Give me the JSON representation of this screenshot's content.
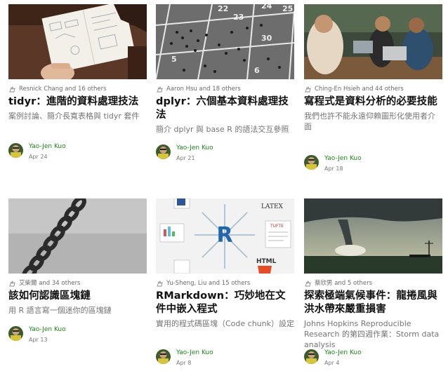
{
  "colors": {
    "author_link": "#1a8917",
    "meta_text": "#6b6b6b",
    "desc_text": "#757575"
  },
  "cards": [
    {
      "image": "notebook-hand-drawing",
      "claps_icon": "clap-icon",
      "claps": "Resnick Chang and 16 others",
      "title": "tidyr：進階的資料處理技法",
      "description": "案例討論、簡介長寬表格與 tidyr 套件",
      "author": "Yao-Jen Kuo",
      "date": "Apr 24"
    },
    {
      "image": "crowd-on-numbered-grid",
      "grid_numbers": [
        "22",
        "23",
        "24",
        "25",
        "30",
        "5",
        "6"
      ],
      "claps_icon": "clap-icon",
      "claps": "Aaron Hsu and 18 others",
      "title": "dplyr：六個基本資料處理技法",
      "description": "簡介 dplyr 與 base R 的語法交互參照",
      "author": "Yao-Jen Kuo",
      "date": "Apr 21"
    },
    {
      "image": "people-with-laptops",
      "claps_icon": "clap-icon",
      "claps": "Ching-En Hsieh and 44 others",
      "title": "寫程式是資料分析的必要技能",
      "description": "我們也許不能永遠仰賴圖形化使用者介面",
      "author": "Yao-Jen Kuo",
      "date": "Apr 18"
    },
    {
      "image": "chain-links",
      "claps_icon": "clap-icon",
      "claps": "艾柴爾 and 34 others",
      "title": "該如何認識區塊鏈",
      "description": "用 R 語言寫一個迷你的區塊鏈",
      "author": "Yao-Jen Kuo",
      "date": "Apr 13"
    },
    {
      "image": "rmarkdown-diagram",
      "diagram_labels": {
        "center": "R",
        "latex": "LATEX",
        "tufte": "TUFTE",
        "html": "HTML"
      },
      "claps_icon": "clap-icon",
      "claps": "Yu-Sheng, Liu and 15 others",
      "title": "RMarkdown：巧妙地在文件中嵌入程式",
      "description": "實用的程式碼區塊（Code chunk）設定",
      "author": "Yao-Jen Kuo",
      "date": "Apr 8"
    },
    {
      "image": "tornado-landscape",
      "claps_icon": "clap-icon",
      "claps": "蔡欣男 and 5 others",
      "title": "探索極端氣候事件：龍捲風與洪水帶來嚴重損害",
      "description": "Johns Hopkins Reproducible Research 的第四週作業：Storm data analysis",
      "author": "Yao-Jen Kuo",
      "date": "Apr 4"
    }
  ]
}
